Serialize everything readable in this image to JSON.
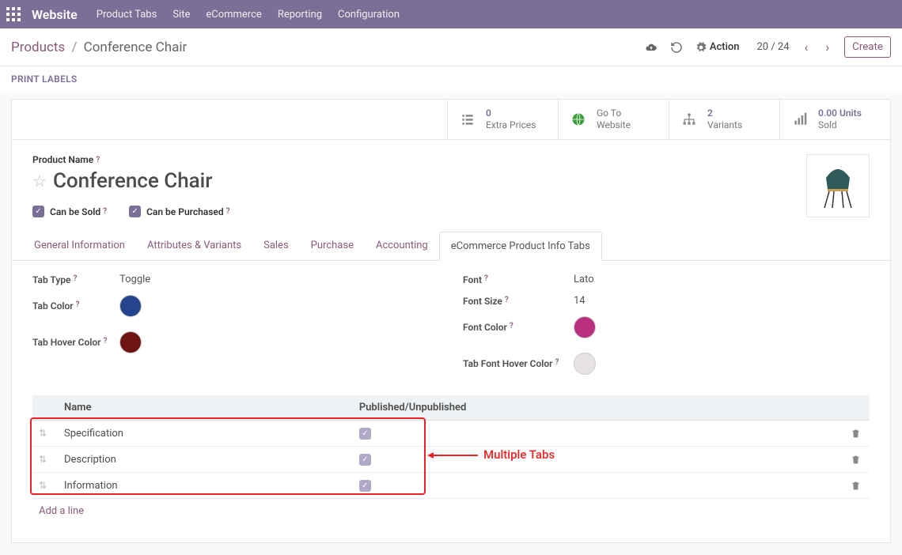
{
  "topbar": {
    "brand": "Website",
    "menu": [
      "Product Tabs",
      "Site",
      "eCommerce",
      "Reporting",
      "Configuration"
    ]
  },
  "header": {
    "breadcrumb_root": "Products",
    "breadcrumb_current": "Conference Chair",
    "action_label": "Action",
    "pager": "20 / 24",
    "create_label": "Create"
  },
  "subheader": {
    "print_labels": "PRINT LABELS"
  },
  "statbar": [
    {
      "value": "0",
      "label": "Extra Prices",
      "icon": "list-icon"
    },
    {
      "value": "",
      "label_top": "Go To",
      "label_bottom": "Website",
      "icon": "globe-icon"
    },
    {
      "value": "2",
      "label": "Variants",
      "icon": "sitemap-icon"
    },
    {
      "value": "0.00 Units",
      "label": "Sold",
      "icon": "bars-icon"
    }
  ],
  "product": {
    "name_label": "Product Name",
    "name": "Conference Chair",
    "sold_label": "Can be Sold",
    "purchased_label": "Can be Purchased"
  },
  "tabs": [
    "General Information",
    "Attributes & Variants",
    "Sales",
    "Purchase",
    "Accounting",
    "eCommerce Product Info Tabs"
  ],
  "active_tab": 5,
  "fields": {
    "left": [
      {
        "label": "Tab Type",
        "value": "Toggle",
        "type": "text"
      },
      {
        "label": "Tab Color",
        "color": "#24448e",
        "type": "swatch"
      },
      {
        "label": "Tab Hover Color",
        "color": "#6e1414",
        "type": "swatch"
      }
    ],
    "right": [
      {
        "label": "Font",
        "value": "Lato",
        "type": "text"
      },
      {
        "label": "Font Size",
        "value": "14",
        "type": "text"
      },
      {
        "label": "Font Color",
        "color": "#b8307f",
        "type": "swatch"
      },
      {
        "label": "Tab Font Hover Color",
        "color": "#e7e3e3",
        "type": "swatch"
      }
    ]
  },
  "subtable": {
    "col_name": "Name",
    "col_pub": "Published/Unpublished",
    "rows": [
      {
        "name": "Specification",
        "published": true
      },
      {
        "name": "Description",
        "published": true
      },
      {
        "name": "Information",
        "published": true
      }
    ],
    "add_line": "Add a line"
  },
  "annotation": "Multiple Tabs"
}
